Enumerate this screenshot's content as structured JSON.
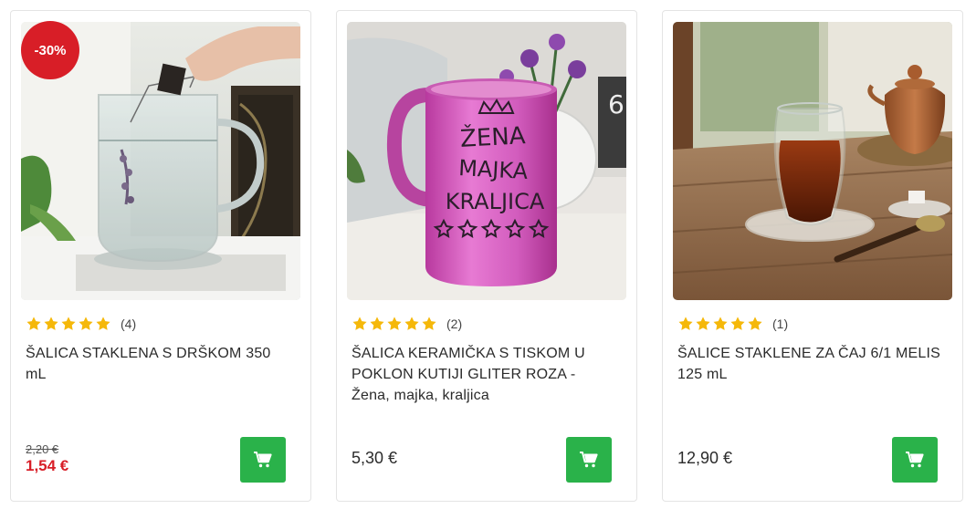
{
  "products": [
    {
      "badge": "-30%",
      "rating_count": "(4)",
      "title": "ŠALICA STAKLENA S DRŠKOM 350 mL",
      "old_price": "2,20 €",
      "price": "1,54 €",
      "stars": 5
    },
    {
      "rating_count": "(2)",
      "title": "ŠALICA KERAMIČKA S TISKOM U POKLON KUTIJI GLITER ROZA - Žena, majka, kraljica",
      "price": "5,30 €",
      "stars": 5,
      "mug_print": [
        "ŽENA",
        "MAJKA",
        "KRALJICA"
      ]
    },
    {
      "rating_count": "(1)",
      "title": "ŠALICE STAKLENE ZA ČAJ 6/1 MELIS 125 mL",
      "price": "12,90 €",
      "stars": 5
    }
  ],
  "icons": {
    "star": "star-icon",
    "cart": "cart-icon"
  },
  "colors": {
    "star": "#f5b80a",
    "sale": "#d81e27",
    "cart_button": "#2ab24a",
    "badge": "#d81e27"
  }
}
